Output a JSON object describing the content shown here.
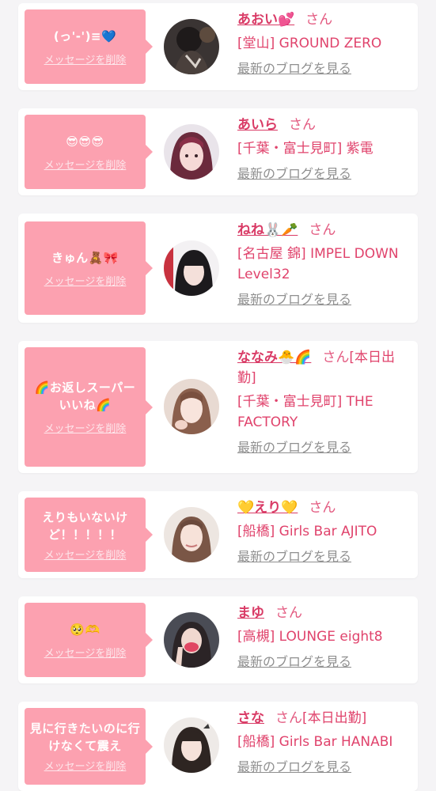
{
  "items": [
    {
      "message": "(っ'-')≡💙",
      "delete": "メッセージを削除",
      "name": "あおい💕",
      "honorific": "さん",
      "status": "",
      "shop": "[堂山] GROUND ZERO",
      "blog": "最新のブログを見る"
    },
    {
      "message": "😎😎😎",
      "delete": "メッセージを削除",
      "name": "あいら",
      "honorific": "さん",
      "status": "",
      "shop": "[千葉・富士見町] 紫電",
      "blog": "最新のブログを見る"
    },
    {
      "message": "きゅん🧸🎀",
      "delete": "メッセージを削除",
      "name": "ねね🐰🥕",
      "honorific": "さん",
      "status": "",
      "shop": "[名古屋 錦] IMPEL DOWN Level32",
      "blog": "最新のブログを見る"
    },
    {
      "message": "🌈お返しスーパーいいね🌈",
      "delete": "メッセージを削除",
      "name": "ななみ🐣🌈",
      "honorific": "さん",
      "status": "[本日出勤]",
      "shop": "[千葉・富士見町] THE FACTORY",
      "blog": "最新のブログを見る"
    },
    {
      "message": "えりもいないけど！！！！！",
      "delete": "メッセージを削除",
      "name": "💛えり💛",
      "honorific": "さん",
      "status": "",
      "shop": "[船橋] Girls Bar AJITO",
      "blog": "最新のブログを見る"
    },
    {
      "message": "🥺🫶",
      "delete": "メッセージを削除",
      "name": "まゆ",
      "honorific": "さん",
      "status": "",
      "shop": "[高槻] LOUNGE eight8",
      "blog": "最新のブログを見る"
    },
    {
      "message": "見に行きたいのに行けなくて震え",
      "delete": "メッセージを削除",
      "name": "さな",
      "honorific": "さん",
      "status": "[本日出勤]",
      "shop": "[船橋] Girls Bar HANABI",
      "blog": "最新のブログを見る"
    }
  ],
  "colors": {
    "bubble": "#fca1b0",
    "name": "#d93b66",
    "shop": "#e0436c",
    "link_gray": "#8f8f8f",
    "background": "#f5f4f6"
  }
}
